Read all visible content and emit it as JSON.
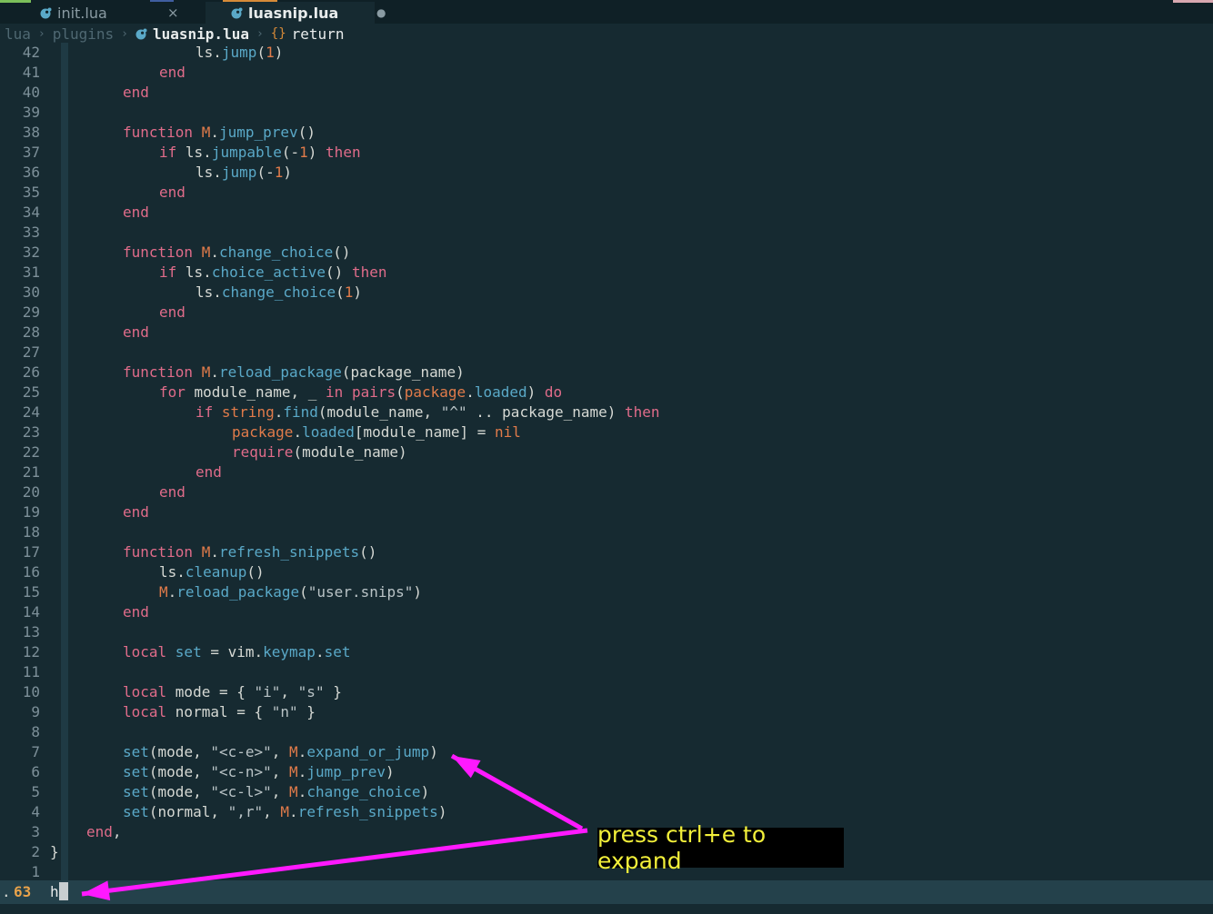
{
  "tabs": [
    {
      "label": "init.lua",
      "close_glyph": "×",
      "active": false
    },
    {
      "label": "luasnip.lua",
      "modified_glyph": "●",
      "active": true
    }
  ],
  "breadcrumb": {
    "segments": [
      "lua",
      "plugins"
    ],
    "file": "luasnip.lua",
    "symbol_icon": "{}",
    "symbol": "return"
  },
  "editor": {
    "lines": [
      {
        "n": "42",
        "indent": 4,
        "tokens": [
          [
            "ls",
            "plain"
          ],
          [
            ".",
            "plain"
          ],
          [
            "jump",
            "fn"
          ],
          [
            "(",
            "plain"
          ],
          [
            "1",
            "num"
          ],
          [
            ")",
            "plain"
          ]
        ]
      },
      {
        "n": "41",
        "indent": 3,
        "tokens": [
          [
            "end",
            "kw"
          ]
        ]
      },
      {
        "n": "40",
        "indent": 2,
        "tokens": [
          [
            "end",
            "kw"
          ]
        ]
      },
      {
        "n": "39",
        "indent": 0,
        "tokens": []
      },
      {
        "n": "38",
        "indent": 2,
        "tokens": [
          [
            "function ",
            "kw"
          ],
          [
            "M",
            "mod"
          ],
          [
            ".",
            "plain"
          ],
          [
            "jump_prev",
            "fn"
          ],
          [
            "()",
            "plain"
          ]
        ]
      },
      {
        "n": "37",
        "indent": 3,
        "tokens": [
          [
            "if ",
            "kw"
          ],
          [
            "ls",
            "plain"
          ],
          [
            ".",
            "plain"
          ],
          [
            "jumpable",
            "fn"
          ],
          [
            "(-",
            "plain"
          ],
          [
            "1",
            "num"
          ],
          [
            ") ",
            "plain"
          ],
          [
            "then",
            "kw"
          ]
        ]
      },
      {
        "n": "36",
        "indent": 4,
        "tokens": [
          [
            "ls",
            "plain"
          ],
          [
            ".",
            "plain"
          ],
          [
            "jump",
            "fn"
          ],
          [
            "(-",
            "plain"
          ],
          [
            "1",
            "num"
          ],
          [
            ")",
            "plain"
          ]
        ]
      },
      {
        "n": "35",
        "indent": 3,
        "tokens": [
          [
            "end",
            "kw"
          ]
        ]
      },
      {
        "n": "34",
        "indent": 2,
        "tokens": [
          [
            "end",
            "kw"
          ]
        ]
      },
      {
        "n": "33",
        "indent": 0,
        "tokens": []
      },
      {
        "n": "32",
        "indent": 2,
        "tokens": [
          [
            "function ",
            "kw"
          ],
          [
            "M",
            "mod"
          ],
          [
            ".",
            "plain"
          ],
          [
            "change_choice",
            "fn"
          ],
          [
            "()",
            "plain"
          ]
        ]
      },
      {
        "n": "31",
        "indent": 3,
        "tokens": [
          [
            "if ",
            "kw"
          ],
          [
            "ls",
            "plain"
          ],
          [
            ".",
            "plain"
          ],
          [
            "choice_active",
            "fn"
          ],
          [
            "() ",
            "plain"
          ],
          [
            "then",
            "kw"
          ]
        ]
      },
      {
        "n": "30",
        "indent": 4,
        "tokens": [
          [
            "ls",
            "plain"
          ],
          [
            ".",
            "plain"
          ],
          [
            "change_choice",
            "fn"
          ],
          [
            "(",
            "plain"
          ],
          [
            "1",
            "num"
          ],
          [
            ")",
            "plain"
          ]
        ]
      },
      {
        "n": "29",
        "indent": 3,
        "tokens": [
          [
            "end",
            "kw"
          ]
        ]
      },
      {
        "n": "28",
        "indent": 2,
        "tokens": [
          [
            "end",
            "kw"
          ]
        ]
      },
      {
        "n": "27",
        "indent": 0,
        "tokens": []
      },
      {
        "n": "26",
        "indent": 2,
        "tokens": [
          [
            "function ",
            "kw"
          ],
          [
            "M",
            "mod"
          ],
          [
            ".",
            "plain"
          ],
          [
            "reload_package",
            "fn"
          ],
          [
            "(package_name)",
            "plain"
          ]
        ]
      },
      {
        "n": "25",
        "indent": 3,
        "tokens": [
          [
            "for ",
            "kw"
          ],
          [
            "module_name, _ ",
            "plain"
          ],
          [
            "in ",
            "kw"
          ],
          [
            "pairs",
            "bi"
          ],
          [
            "(",
            "plain"
          ],
          [
            "package",
            "mod"
          ],
          [
            ".",
            "plain"
          ],
          [
            "loaded",
            "fn"
          ],
          [
            ") ",
            "plain"
          ],
          [
            "do",
            "kw"
          ]
        ]
      },
      {
        "n": "24",
        "indent": 4,
        "tokens": [
          [
            "if ",
            "kw"
          ],
          [
            "string",
            "mod"
          ],
          [
            ".",
            "plain"
          ],
          [
            "find",
            "fn"
          ],
          [
            "(module_name, ",
            "plain"
          ],
          [
            "\"^\"",
            "str"
          ],
          [
            " .. package_name) ",
            "plain"
          ],
          [
            "then",
            "kw"
          ]
        ]
      },
      {
        "n": "23",
        "indent": 5,
        "tokens": [
          [
            "package",
            "mod"
          ],
          [
            ".",
            "plain"
          ],
          [
            "loaded",
            "fn"
          ],
          [
            "[module_name] = ",
            "plain"
          ],
          [
            "nil",
            "num"
          ]
        ]
      },
      {
        "n": "22",
        "indent": 5,
        "tokens": [
          [
            "require",
            "bi"
          ],
          [
            "(module_name)",
            "plain"
          ]
        ]
      },
      {
        "n": "21",
        "indent": 4,
        "tokens": [
          [
            "end",
            "kw"
          ]
        ]
      },
      {
        "n": "20",
        "indent": 3,
        "tokens": [
          [
            "end",
            "kw"
          ]
        ]
      },
      {
        "n": "19",
        "indent": 2,
        "tokens": [
          [
            "end",
            "kw"
          ]
        ]
      },
      {
        "n": "18",
        "indent": 0,
        "tokens": []
      },
      {
        "n": "17",
        "indent": 2,
        "tokens": [
          [
            "function ",
            "kw"
          ],
          [
            "M",
            "mod"
          ],
          [
            ".",
            "plain"
          ],
          [
            "refresh_snippets",
            "fn"
          ],
          [
            "()",
            "plain"
          ]
        ]
      },
      {
        "n": "16",
        "indent": 3,
        "tokens": [
          [
            "ls",
            "plain"
          ],
          [
            ".",
            "plain"
          ],
          [
            "cleanup",
            "fn"
          ],
          [
            "()",
            "plain"
          ]
        ]
      },
      {
        "n": "15",
        "indent": 3,
        "tokens": [
          [
            "M",
            "mod"
          ],
          [
            ".",
            "plain"
          ],
          [
            "reload_package",
            "fn"
          ],
          [
            "(",
            "plain"
          ],
          [
            "\"user.snips\"",
            "str"
          ],
          [
            ")",
            "plain"
          ]
        ]
      },
      {
        "n": "14",
        "indent": 2,
        "tokens": [
          [
            "end",
            "kw"
          ]
        ]
      },
      {
        "n": "13",
        "indent": 0,
        "tokens": []
      },
      {
        "n": "12",
        "indent": 2,
        "tokens": [
          [
            "local ",
            "kw"
          ],
          [
            "set",
            "fn"
          ],
          [
            " = vim",
            "plain"
          ],
          [
            ".",
            "plain"
          ],
          [
            "keymap",
            "fn"
          ],
          [
            ".",
            "plain"
          ],
          [
            "set",
            "fn"
          ]
        ]
      },
      {
        "n": "11",
        "indent": 0,
        "tokens": []
      },
      {
        "n": "10",
        "indent": 2,
        "tokens": [
          [
            "local ",
            "kw"
          ],
          [
            "mode = { ",
            "plain"
          ],
          [
            "\"i\"",
            "str"
          ],
          [
            ", ",
            "plain"
          ],
          [
            "\"s\"",
            "str"
          ],
          [
            " }",
            "plain"
          ]
        ]
      },
      {
        "n": "9",
        "indent": 2,
        "tokens": [
          [
            "local ",
            "kw"
          ],
          [
            "normal = { ",
            "plain"
          ],
          [
            "\"n\"",
            "str"
          ],
          [
            " }",
            "plain"
          ]
        ]
      },
      {
        "n": "8",
        "indent": 0,
        "tokens": []
      },
      {
        "n": "7",
        "indent": 2,
        "tokens": [
          [
            "set",
            "fn"
          ],
          [
            "(mode, ",
            "plain"
          ],
          [
            "\"<c-e>\"",
            "str"
          ],
          [
            ", ",
            "plain"
          ],
          [
            "M",
            "mod"
          ],
          [
            ".",
            "plain"
          ],
          [
            "expand_or_jump",
            "fn"
          ],
          [
            ")",
            "plain"
          ]
        ]
      },
      {
        "n": "6",
        "indent": 2,
        "tokens": [
          [
            "set",
            "fn"
          ],
          [
            "(mode, ",
            "plain"
          ],
          [
            "\"<c-n>\"",
            "str"
          ],
          [
            ", ",
            "plain"
          ],
          [
            "M",
            "mod"
          ],
          [
            ".",
            "plain"
          ],
          [
            "jump_prev",
            "fn"
          ],
          [
            ")",
            "plain"
          ]
        ]
      },
      {
        "n": "5",
        "indent": 2,
        "tokens": [
          [
            "set",
            "fn"
          ],
          [
            "(mode, ",
            "plain"
          ],
          [
            "\"<c-l>\"",
            "str"
          ],
          [
            ", ",
            "plain"
          ],
          [
            "M",
            "mod"
          ],
          [
            ".",
            "plain"
          ],
          [
            "change_choice",
            "fn"
          ],
          [
            ")",
            "plain"
          ]
        ]
      },
      {
        "n": "4",
        "indent": 2,
        "tokens": [
          [
            "set",
            "fn"
          ],
          [
            "(normal, ",
            "plain"
          ],
          [
            "\",r\"",
            "str"
          ],
          [
            ", ",
            "plain"
          ],
          [
            "M",
            "mod"
          ],
          [
            ".",
            "plain"
          ],
          [
            "refresh_snippets",
            "fn"
          ],
          [
            ")",
            "plain"
          ]
        ]
      },
      {
        "n": "3",
        "indent": 1,
        "tokens": [
          [
            "end",
            "kw"
          ],
          [
            ",",
            "plain"
          ]
        ]
      },
      {
        "n": "2",
        "indent": 0,
        "tokens": [
          [
            "}",
            "plain"
          ]
        ]
      },
      {
        "n": "1",
        "indent": 0,
        "tokens": []
      }
    ]
  },
  "statusline": {
    "dot": ".",
    "line_number": "63",
    "command_text": "h"
  },
  "annotation": {
    "text": "press ctrl+e to expand",
    "color": "#ff19ff"
  }
}
